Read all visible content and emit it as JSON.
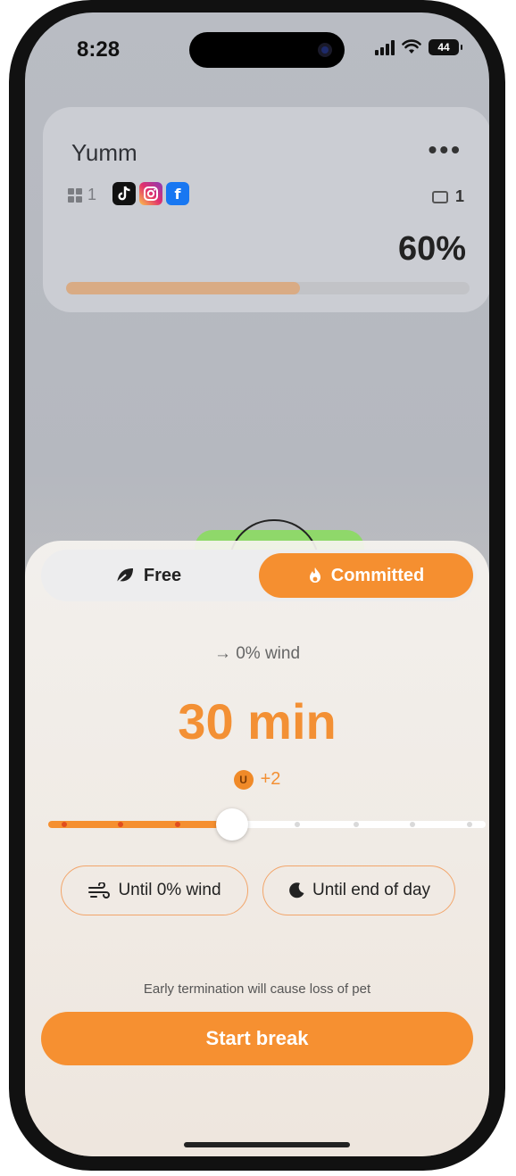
{
  "status": {
    "time": "8:28",
    "battery": "44"
  },
  "widget": {
    "title": "Yumm",
    "more": "•••",
    "group_count": "1",
    "apps": [
      "tiktok-icon",
      "instagram-icon",
      "facebook-icon"
    ],
    "keyboard_count": "1",
    "percent": "60%",
    "progress": 0.58
  },
  "sheet": {
    "modes": {
      "free": "Free",
      "committed": "Committed",
      "selected": "committed"
    },
    "wind_text": "→ 0% wind",
    "duration": "30 min",
    "reward": "+2",
    "coin_symbol": "U",
    "slider": {
      "value_fraction": 0.42
    },
    "quick_options": {
      "until_wind": "Until 0% wind",
      "until_day_end": "Until end of day"
    },
    "warning": "Early termination will cause loss of pet",
    "start_label": "Start break"
  },
  "colors": {
    "accent": "#f58f30",
    "progress": "#d9ab84"
  }
}
